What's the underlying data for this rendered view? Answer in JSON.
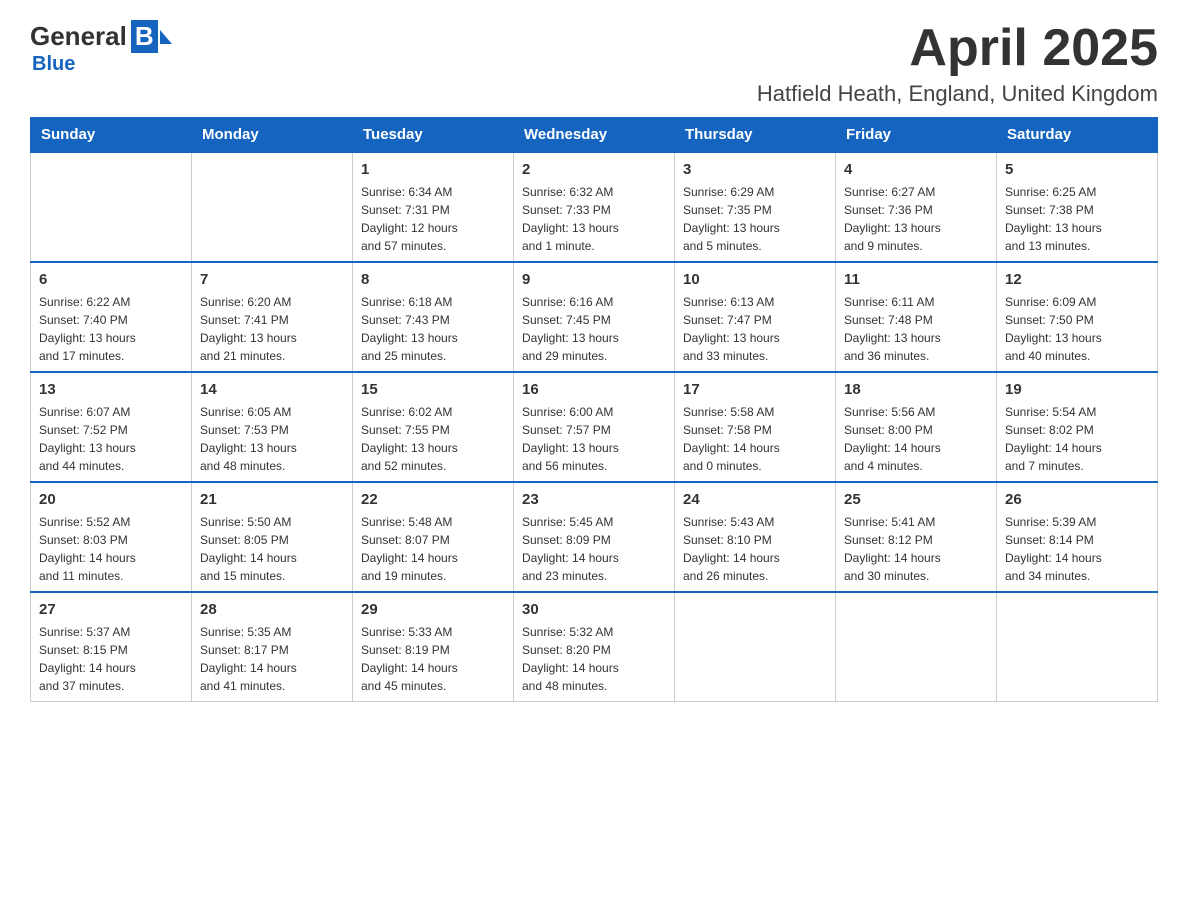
{
  "logo": {
    "general": "General",
    "blue": "Blue",
    "subtitle": "Blue"
  },
  "header": {
    "month_year": "April 2025",
    "location": "Hatfield Heath, England, United Kingdom"
  },
  "weekdays": [
    "Sunday",
    "Monday",
    "Tuesday",
    "Wednesday",
    "Thursday",
    "Friday",
    "Saturday"
  ],
  "weeks": [
    [
      {
        "day": "",
        "info": ""
      },
      {
        "day": "",
        "info": ""
      },
      {
        "day": "1",
        "info": "Sunrise: 6:34 AM\nSunset: 7:31 PM\nDaylight: 12 hours\nand 57 minutes."
      },
      {
        "day": "2",
        "info": "Sunrise: 6:32 AM\nSunset: 7:33 PM\nDaylight: 13 hours\nand 1 minute."
      },
      {
        "day": "3",
        "info": "Sunrise: 6:29 AM\nSunset: 7:35 PM\nDaylight: 13 hours\nand 5 minutes."
      },
      {
        "day": "4",
        "info": "Sunrise: 6:27 AM\nSunset: 7:36 PM\nDaylight: 13 hours\nand 9 minutes."
      },
      {
        "day": "5",
        "info": "Sunrise: 6:25 AM\nSunset: 7:38 PM\nDaylight: 13 hours\nand 13 minutes."
      }
    ],
    [
      {
        "day": "6",
        "info": "Sunrise: 6:22 AM\nSunset: 7:40 PM\nDaylight: 13 hours\nand 17 minutes."
      },
      {
        "day": "7",
        "info": "Sunrise: 6:20 AM\nSunset: 7:41 PM\nDaylight: 13 hours\nand 21 minutes."
      },
      {
        "day": "8",
        "info": "Sunrise: 6:18 AM\nSunset: 7:43 PM\nDaylight: 13 hours\nand 25 minutes."
      },
      {
        "day": "9",
        "info": "Sunrise: 6:16 AM\nSunset: 7:45 PM\nDaylight: 13 hours\nand 29 minutes."
      },
      {
        "day": "10",
        "info": "Sunrise: 6:13 AM\nSunset: 7:47 PM\nDaylight: 13 hours\nand 33 minutes."
      },
      {
        "day": "11",
        "info": "Sunrise: 6:11 AM\nSunset: 7:48 PM\nDaylight: 13 hours\nand 36 minutes."
      },
      {
        "day": "12",
        "info": "Sunrise: 6:09 AM\nSunset: 7:50 PM\nDaylight: 13 hours\nand 40 minutes."
      }
    ],
    [
      {
        "day": "13",
        "info": "Sunrise: 6:07 AM\nSunset: 7:52 PM\nDaylight: 13 hours\nand 44 minutes."
      },
      {
        "day": "14",
        "info": "Sunrise: 6:05 AM\nSunset: 7:53 PM\nDaylight: 13 hours\nand 48 minutes."
      },
      {
        "day": "15",
        "info": "Sunrise: 6:02 AM\nSunset: 7:55 PM\nDaylight: 13 hours\nand 52 minutes."
      },
      {
        "day": "16",
        "info": "Sunrise: 6:00 AM\nSunset: 7:57 PM\nDaylight: 13 hours\nand 56 minutes."
      },
      {
        "day": "17",
        "info": "Sunrise: 5:58 AM\nSunset: 7:58 PM\nDaylight: 14 hours\nand 0 minutes."
      },
      {
        "day": "18",
        "info": "Sunrise: 5:56 AM\nSunset: 8:00 PM\nDaylight: 14 hours\nand 4 minutes."
      },
      {
        "day": "19",
        "info": "Sunrise: 5:54 AM\nSunset: 8:02 PM\nDaylight: 14 hours\nand 7 minutes."
      }
    ],
    [
      {
        "day": "20",
        "info": "Sunrise: 5:52 AM\nSunset: 8:03 PM\nDaylight: 14 hours\nand 11 minutes."
      },
      {
        "day": "21",
        "info": "Sunrise: 5:50 AM\nSunset: 8:05 PM\nDaylight: 14 hours\nand 15 minutes."
      },
      {
        "day": "22",
        "info": "Sunrise: 5:48 AM\nSunset: 8:07 PM\nDaylight: 14 hours\nand 19 minutes."
      },
      {
        "day": "23",
        "info": "Sunrise: 5:45 AM\nSunset: 8:09 PM\nDaylight: 14 hours\nand 23 minutes."
      },
      {
        "day": "24",
        "info": "Sunrise: 5:43 AM\nSunset: 8:10 PM\nDaylight: 14 hours\nand 26 minutes."
      },
      {
        "day": "25",
        "info": "Sunrise: 5:41 AM\nSunset: 8:12 PM\nDaylight: 14 hours\nand 30 minutes."
      },
      {
        "day": "26",
        "info": "Sunrise: 5:39 AM\nSunset: 8:14 PM\nDaylight: 14 hours\nand 34 minutes."
      }
    ],
    [
      {
        "day": "27",
        "info": "Sunrise: 5:37 AM\nSunset: 8:15 PM\nDaylight: 14 hours\nand 37 minutes."
      },
      {
        "day": "28",
        "info": "Sunrise: 5:35 AM\nSunset: 8:17 PM\nDaylight: 14 hours\nand 41 minutes."
      },
      {
        "day": "29",
        "info": "Sunrise: 5:33 AM\nSunset: 8:19 PM\nDaylight: 14 hours\nand 45 minutes."
      },
      {
        "day": "30",
        "info": "Sunrise: 5:32 AM\nSunset: 8:20 PM\nDaylight: 14 hours\nand 48 minutes."
      },
      {
        "day": "",
        "info": ""
      },
      {
        "day": "",
        "info": ""
      },
      {
        "day": "",
        "info": ""
      }
    ]
  ]
}
